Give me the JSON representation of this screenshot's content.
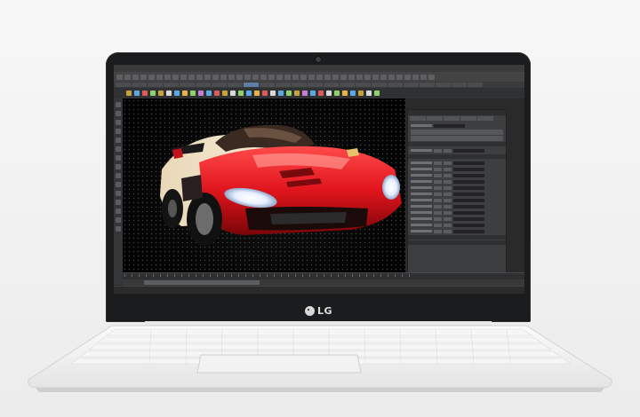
{
  "brand": {
    "logo_text": "LG"
  },
  "scene": {
    "subject": "car-render",
    "colors": {
      "car_body": "#e0141c",
      "car_highlight": "#f3e6cc",
      "background": "#050505",
      "laptop_body": "#f4f4f4",
      "bezel": "#1b1c1e"
    }
  }
}
